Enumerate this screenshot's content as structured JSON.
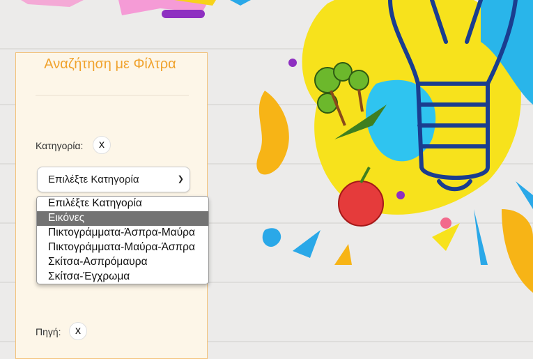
{
  "panel": {
    "title": "Αναζήτηση με Φίλτρα",
    "category_label": "Κατηγορία:",
    "category_clear": "x",
    "source_label": "Πηγή:",
    "source_clear": "x"
  },
  "category_select": {
    "selected_value": "Επιλέξτε Κατηγορία",
    "highlighted_index": 1,
    "options": [
      "Επιλέξτε Κατηγορία",
      "Εικόνες",
      "Πικτογράμματα-Άσπρα-Μαύρα",
      "Πικτογράμματα-Μαύρα-Άσπρα",
      "Σκίτσα-Ασπρόμαυρα",
      "Σκίτσα-Έγχρωμα"
    ]
  },
  "colors": {
    "accent": "#f0a22c",
    "panel_bg": "#fdf6e8",
    "option_highlight": "#737373"
  }
}
